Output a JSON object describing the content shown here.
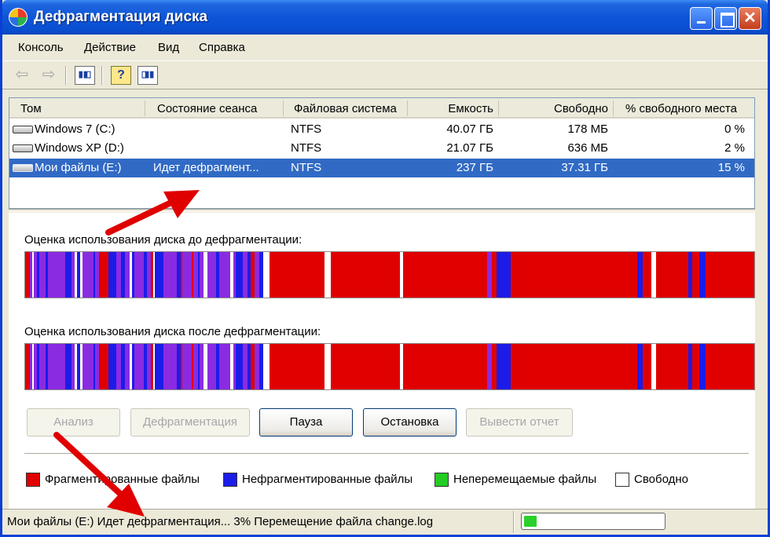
{
  "window": {
    "title": "Дефрагментация диска"
  },
  "menu": [
    "Консоль",
    "Действие",
    "Вид",
    "Справка"
  ],
  "toolbar": {
    "back_icon": "arrow-left-icon",
    "forward_icon": "arrow-right-icon",
    "show_hide_icon": "console-tree-icon",
    "help_icon": "help-icon",
    "action_pane_icon": "action-pane-icon"
  },
  "columns": [
    "Том",
    "Состояние сеанса",
    "Файловая система",
    "Емкость",
    "Свободно",
    "% свободного места"
  ],
  "volumes": [
    {
      "name": "Windows 7 (C:)",
      "status": "",
      "fs": "NTFS",
      "capacity": "40.07 ГБ",
      "free": "178 МБ",
      "free_pct": "0 %",
      "selected": false
    },
    {
      "name": "Windows XP (D:)",
      "status": "",
      "fs": "NTFS",
      "capacity": "21.07 ГБ",
      "free": "636 МБ",
      "free_pct": "2 %",
      "selected": false
    },
    {
      "name": "Мои файлы (E:)",
      "status": "Идет дефрагмент...",
      "fs": "NTFS",
      "capacity": "237 ГБ",
      "free": "37.31 ГБ",
      "free_pct": "15 %",
      "selected": true
    }
  ],
  "maps": {
    "before_label": "Оценка использования диска до дефрагментации:",
    "after_label": "Оценка использования диска после дефрагментации:"
  },
  "buttons": {
    "analyze": "Анализ",
    "defrag": "Дефрагментация",
    "pause": "Пауза",
    "stop": "Остановка",
    "report": "Вывести отчет"
  },
  "legend": [
    {
      "label": "Фрагментированные файлы",
      "color": "#e00000"
    },
    {
      "label": "Нефрагментированные файлы",
      "color": "#1c1ce8"
    },
    {
      "label": "Неперемещаемые файлы",
      "color": "#22cc22"
    },
    {
      "label": "Свободно",
      "color": "#ffffff"
    }
  ],
  "status": {
    "text": "Мои файлы (E:) Идет дефрагментация... 3% Перемещение файла change.log",
    "progress": 0.03
  },
  "colors": {
    "fragmented": "#e00000",
    "contiguous": "#1c1ce8",
    "unmovable": "#22cc22",
    "free": "#ffffff",
    "mixed": "#8a2be2",
    "selection": "#316ac5",
    "annotation_arrow": "#e00000"
  }
}
